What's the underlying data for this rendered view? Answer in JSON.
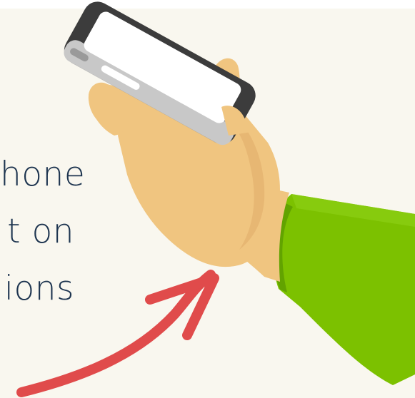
{
  "caption": {
    "lines": [
      "hone",
      "t on",
      "ions"
    ]
  },
  "colors": {
    "background": "#f9f7ef",
    "text": "#1e3550",
    "skin": "#f0c580",
    "skin_shadow": "#e2b06e",
    "sleeve": "#7cc100",
    "sleeve_shadow": "#62a300",
    "phone_body": "#3c3c3c",
    "phone_edge": "#c8c8c8",
    "screen": "#ffffff",
    "arrow": "#e04b4b"
  },
  "icons": {
    "hand": "hand-holding-phone-icon",
    "arrow": "curved-arrow-icon"
  }
}
